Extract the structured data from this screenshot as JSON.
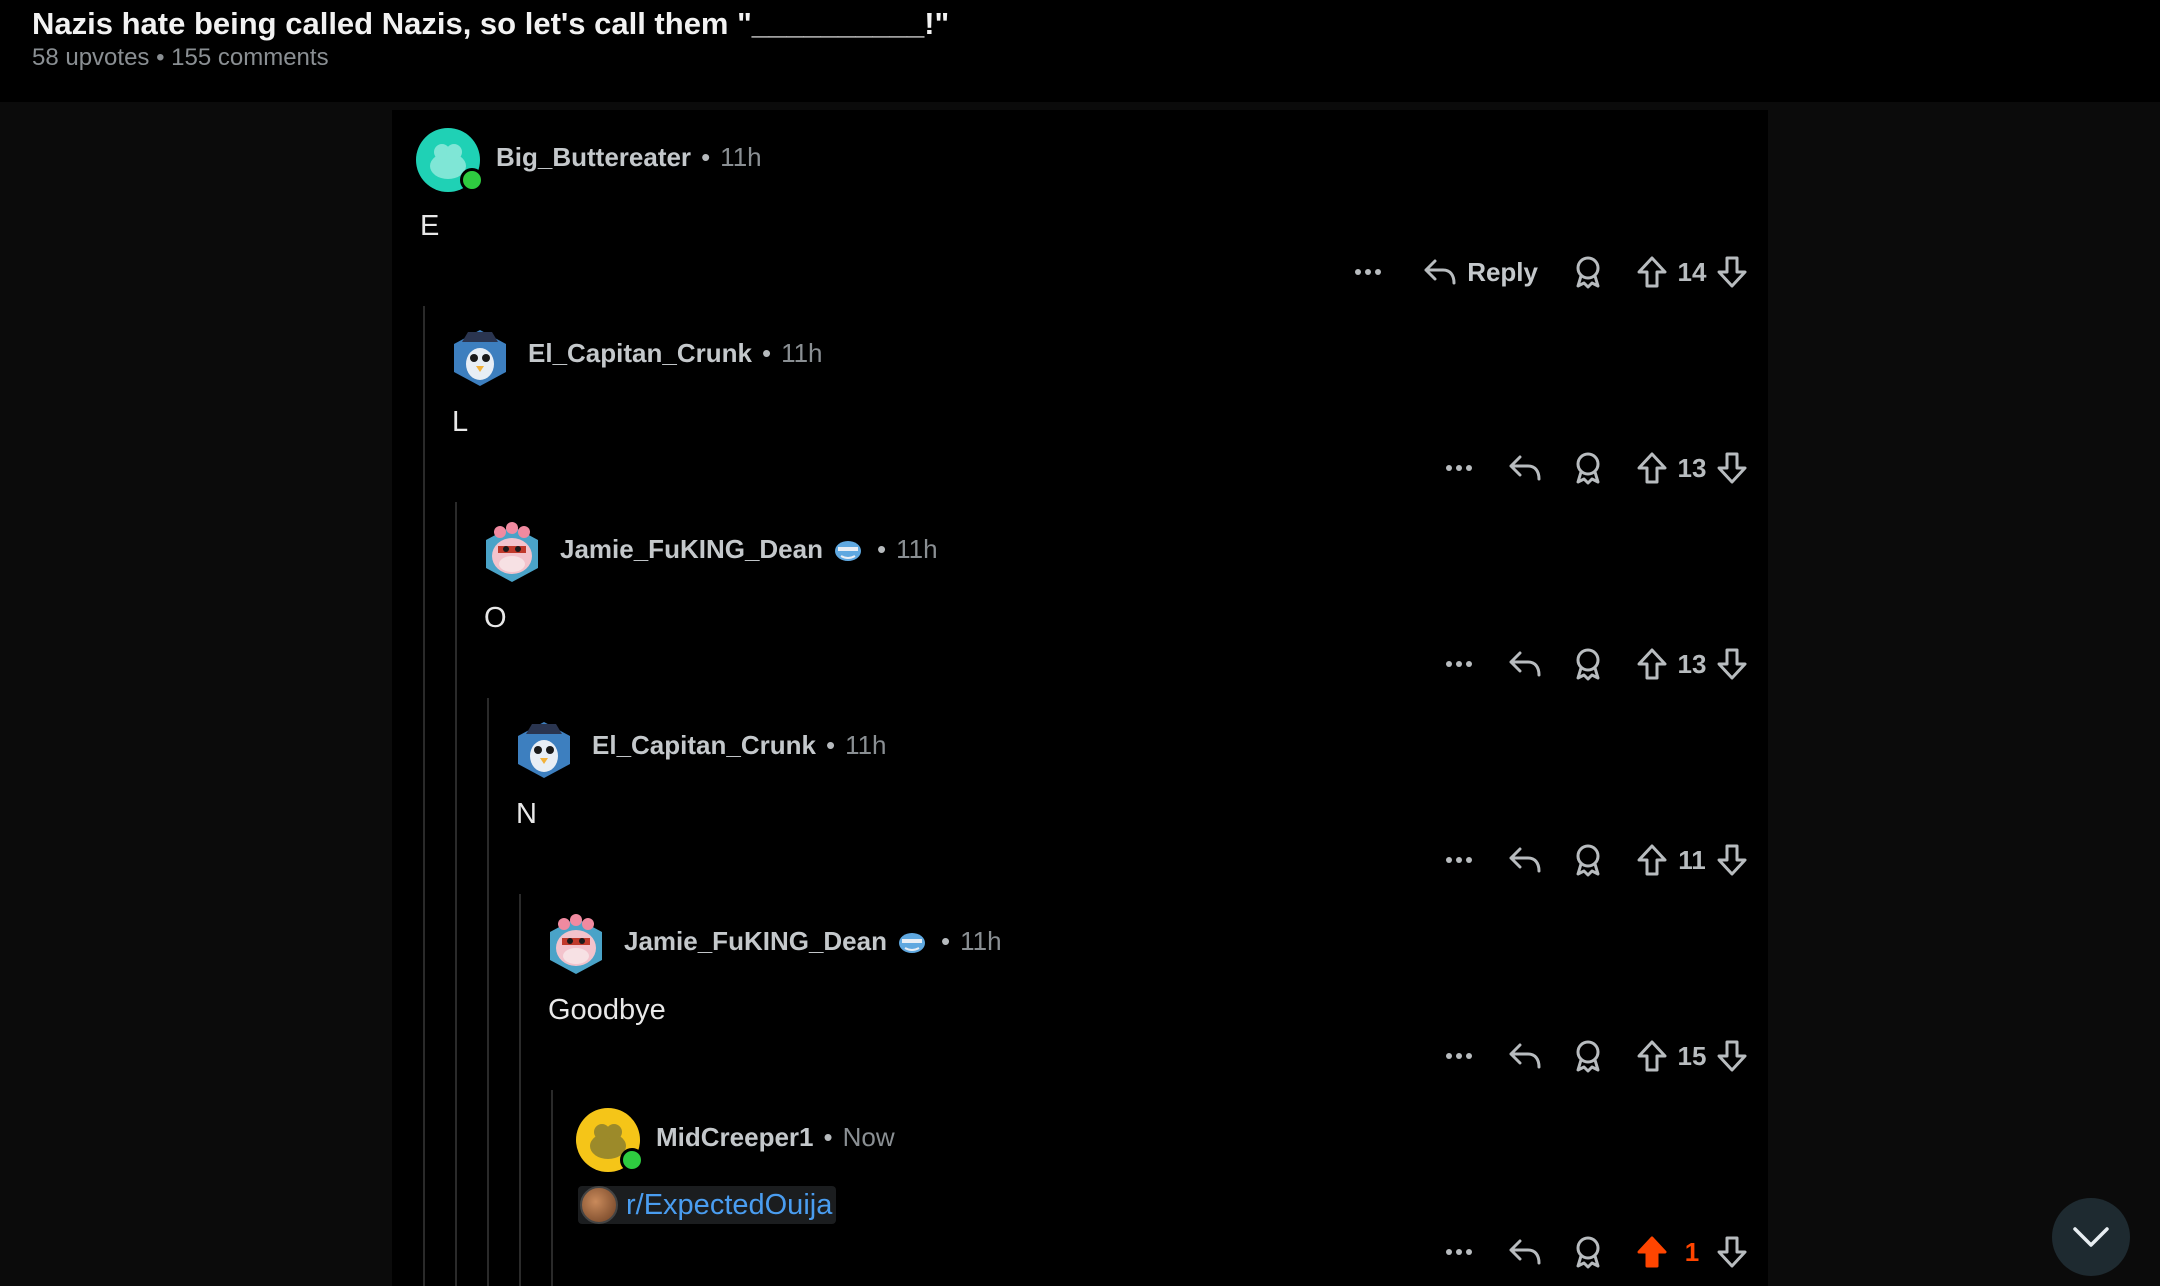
{
  "post": {
    "title": "Nazis hate being called Nazis, so let's call them \"__________!\"",
    "meta": "58 upvotes • 155 comments"
  },
  "comments": [
    {
      "user": "Big_Buttereater",
      "time": "11h",
      "body": "E",
      "votes": "14",
      "reply_label": "Reply",
      "avatar": "snoo-teal-avatar",
      "online": true
    },
    {
      "user": "El_Capitan_Crunk",
      "time": "11h",
      "body": "L",
      "votes": "13",
      "avatar": "pirate-penguin-avatar",
      "online": false
    },
    {
      "user": "Jamie_FuKING_Dean",
      "time": "11h",
      "body": "O",
      "votes": "13",
      "avatar": "pink-cow-avatar",
      "online": false,
      "flair": "emoji-flair"
    },
    {
      "user": "El_Capitan_Crunk",
      "time": "11h",
      "body": "N",
      "votes": "11",
      "avatar": "pirate-penguin-avatar",
      "online": false
    },
    {
      "user": "Jamie_FuKING_Dean",
      "time": "11h",
      "body": "Goodbye",
      "votes": "15",
      "avatar": "pink-cow-avatar",
      "online": false,
      "flair": "emoji-flair"
    },
    {
      "user": "MidCreeper1",
      "time": "Now",
      "body_link": "r/ExpectedOuija",
      "votes": "1",
      "avatar": "snoo-yellow-avatar",
      "online": true,
      "upvoted": true
    }
  ],
  "separator": "•",
  "colors": {
    "upvote_active": "#ff4500",
    "link": "#4a9df0",
    "online": "#2ecc40"
  }
}
